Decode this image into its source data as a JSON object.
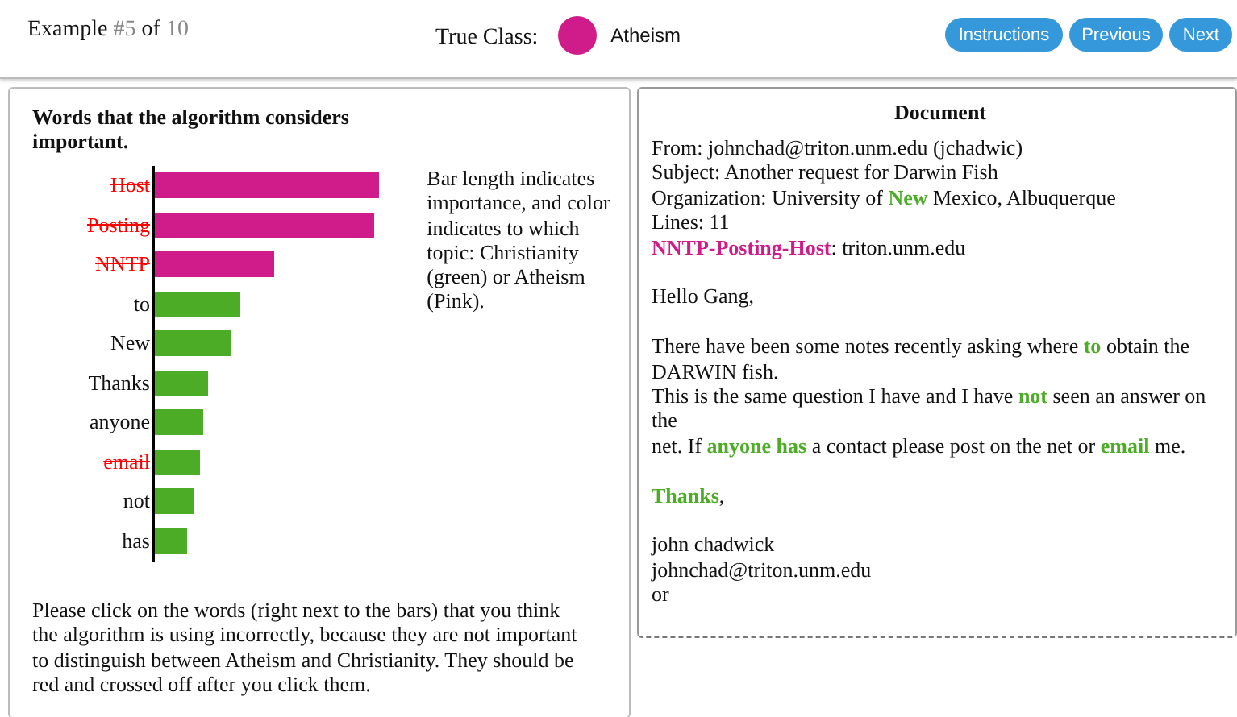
{
  "header": {
    "example": [
      {
        "text": "Example "
      },
      {
        "text": "#5",
        "muted": true
      },
      {
        "text": " of "
      },
      {
        "text": "10",
        "muted": true
      }
    ],
    "true_class": {
      "label": "True Class:",
      "name": "Atheism",
      "color": "#d01c8b"
    },
    "buttons": [
      "Instructions",
      "Previous",
      "Next"
    ]
  },
  "explanation": {
    "title": "Words that the algorithm considers important.",
    "legend": "Bar length indicates importance, and color indicates to which topic: Christianity (green) or Atheism (Pink).",
    "words": [
      {
        "word": "Host",
        "level": 0.98,
        "color": "#d01c8b",
        "crossed": true
      },
      {
        "word": "Posting",
        "level": 0.96,
        "color": "#d01c8b",
        "crossed": true
      },
      {
        "word": "NNTP",
        "level": 0.52,
        "color": "#d01c8b",
        "crossed": true
      },
      {
        "word": "to",
        "level": 0.37,
        "color": "#4dac26",
        "crossed": false
      },
      {
        "word": "New",
        "level": 0.33,
        "color": "#4dac26",
        "crossed": false
      },
      {
        "word": "Thanks",
        "level": 0.23,
        "color": "#4dac26",
        "crossed": false
      },
      {
        "word": "anyone",
        "level": 0.21,
        "color": "#4dac26",
        "crossed": false
      },
      {
        "word": "email",
        "level": 0.2,
        "color": "#4dac26",
        "crossed": true
      },
      {
        "word": "not",
        "level": 0.17,
        "color": "#4dac26",
        "crossed": false
      },
      {
        "word": "has",
        "level": 0.14,
        "color": "#4dac26",
        "crossed": false
      }
    ],
    "instructions": "Please click on the words (right next to the bars) that you think the algorithm is using incorrectly, because they are not important to distinguish between Atheism and Christianity. They should be red and crossed off after you click them."
  },
  "document": {
    "title": "Document",
    "paragraphs": [
      {
        "lines": [
          [
            {
              "text": "From: johnchad@triton.unm.edu (jchadwic)"
            }
          ],
          [
            {
              "text": "Subject: Another request for Darwin Fish"
            }
          ],
          [
            {
              "text": "Organization: University of "
            },
            {
              "text": "New",
              "color": "#4dac26"
            },
            {
              "text": " Mexico, Albuquerque"
            }
          ],
          [
            {
              "text": "Lines: 11"
            }
          ],
          [
            {
              "text": "NNTP",
              "color": "#d01c8b"
            },
            {
              "text": "-",
              "color": "#d01c8b"
            },
            {
              "text": "Posting",
              "color": "#d01c8b"
            },
            {
              "text": "-",
              "color": "#d01c8b"
            },
            {
              "text": "Host",
              "color": "#d01c8b"
            },
            {
              "text": ": triton.unm.edu"
            }
          ]
        ]
      },
      {
        "lines": [
          [
            {
              "text": "Hello Gang,"
            }
          ]
        ]
      },
      {
        "lines": [
          [
            {
              "text": "There have been some notes recently asking where "
            },
            {
              "text": "to",
              "color": "#4dac26"
            },
            {
              "text": " obtain the"
            }
          ],
          [
            {
              "text": "DARWIN fish."
            }
          ],
          [
            {
              "text": "This is the same question I have and I have "
            },
            {
              "text": "not",
              "color": "#4dac26"
            },
            {
              "text": " seen an answer on"
            }
          ],
          [
            {
              "text": "the"
            }
          ],
          [
            {
              "text": "net. If "
            },
            {
              "text": "anyone",
              "color": "#4dac26"
            },
            {
              "text": " has",
              "color": "#4dac26"
            },
            {
              "text": " a contact please post on the net or "
            },
            {
              "text": "email",
              "color": "#4dac26"
            },
            {
              "text": " me."
            }
          ]
        ]
      },
      {
        "lines": [
          [
            {
              "text": "Thanks",
              "color": "#4dac26"
            },
            {
              "text": ","
            }
          ]
        ]
      },
      {
        "lines": [
          [
            {
              "text": "john chadwick"
            }
          ],
          [
            {
              "text": "johnchad@triton.unm.edu"
            }
          ],
          [
            {
              "text": "or"
            }
          ]
        ]
      }
    ]
  }
}
